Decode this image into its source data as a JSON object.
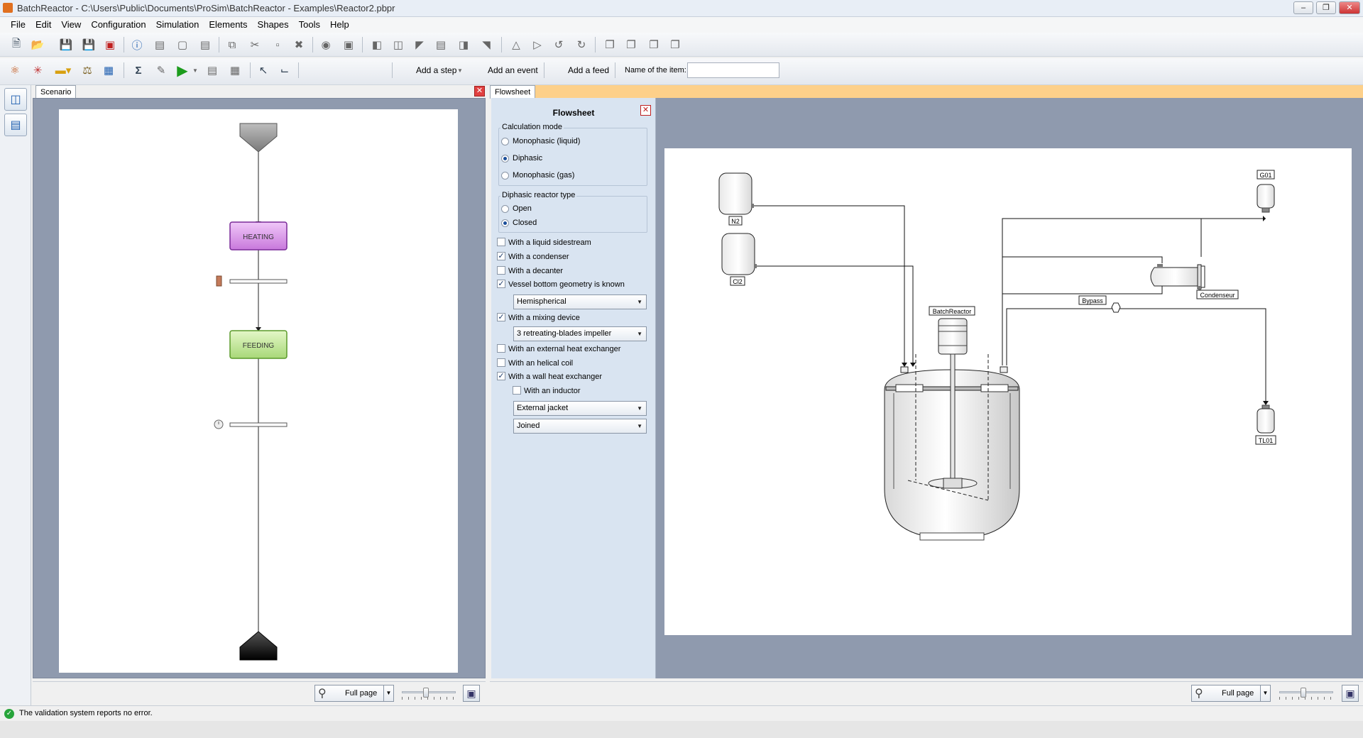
{
  "window": {
    "title": "BatchReactor - C:\\Users\\Public\\Documents\\ProSim\\BatchReactor - Examples\\Reactor2.pbpr"
  },
  "menu": [
    "File",
    "Edit",
    "View",
    "Configuration",
    "Simulation",
    "Elements",
    "Shapes",
    "Tools",
    "Help"
  ],
  "toolbar": {
    "add_step_label": "Add a step",
    "add_event_label": "Add an event",
    "add_feed_label": "Add a feed",
    "item_name_label": "Name of the item:",
    "item_name_value": ""
  },
  "scenario": {
    "tab_label": "Scenario",
    "steps": [
      {
        "label": "HEATING",
        "color": "#d89ae6"
      },
      {
        "label": "FEEDING",
        "color": "#b4e08a"
      }
    ],
    "zoom_label": "Full page"
  },
  "flowsheet": {
    "tab_label": "Flowsheet",
    "panel_title": "Flowsheet",
    "calc_mode_label": "Calculation mode",
    "calc_modes": [
      {
        "label": "Monophasic (liquid)",
        "selected": false
      },
      {
        "label": "Diphasic",
        "selected": true
      },
      {
        "label": "Monophasic (gas)",
        "selected": false
      }
    ],
    "reactor_type_label": "Diphasic reactor type",
    "reactor_types": [
      {
        "label": "Open",
        "selected": false
      },
      {
        "label": "Closed",
        "selected": true
      }
    ],
    "options": [
      {
        "label": "With a liquid sidestream",
        "checked": false
      },
      {
        "label": "With a condenser",
        "checked": true
      },
      {
        "label": "With a decanter",
        "checked": false
      },
      {
        "label": "Vessel bottom geometry is known",
        "checked": true
      },
      {
        "label": "With a mixing device",
        "checked": true
      },
      {
        "label": "With an external heat exchanger",
        "checked": false
      },
      {
        "label": "With an helical coil",
        "checked": false
      },
      {
        "label": "With a wall heat exchanger",
        "checked": true
      },
      {
        "label": "With an inductor",
        "checked": false
      }
    ],
    "bottom_geometry_value": "Hemispherical",
    "mixing_device_value": "3 retreating-blades impeller",
    "wall_exchanger_value": "External jacket",
    "joined_value": "Joined",
    "units": {
      "n2": "N2",
      "cl2": "Cl2",
      "g01": "G01",
      "tl01": "TL01",
      "reactor": "BatchReactor",
      "condenser": "Condenseur",
      "bypass": "Bypass"
    },
    "zoom_label": "Full page"
  },
  "status": {
    "message": "The validation system reports no error.",
    "ok_color": "#27a43a"
  }
}
